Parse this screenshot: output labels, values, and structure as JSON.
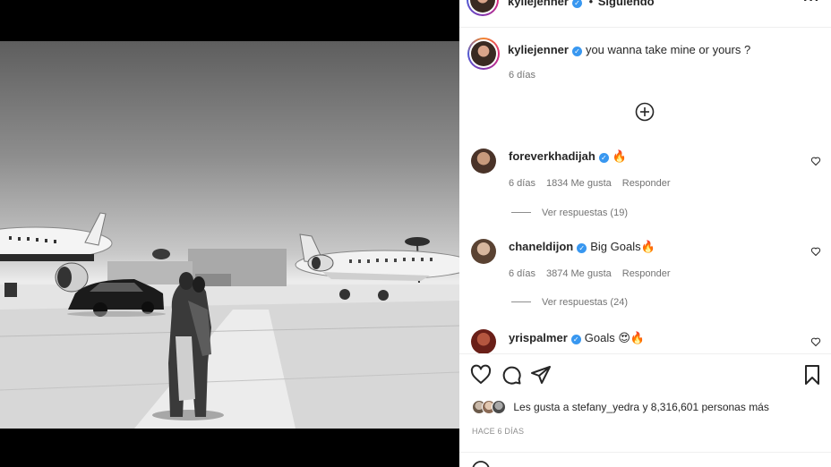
{
  "post": {
    "author": "kyliejenner",
    "follow_status": "Siguiendo",
    "more_icon": "more-horizontal-icon",
    "caption": {
      "username": "kyliejenner",
      "text": "you wanna take mine or yours ?",
      "time": "6 días"
    }
  },
  "load_more_icon": "plus-circle-icon",
  "comments": [
    {
      "username": "foreverkhadijah",
      "text": "🔥",
      "time": "6 días",
      "likes": "1834 Me gusta",
      "reply_label": "Responder",
      "view_replies": "Ver respuestas (19)"
    },
    {
      "username": "chaneldijon",
      "text": "Big Goals🔥",
      "time": "6 días",
      "likes": "3874 Me gusta",
      "reply_label": "Responder",
      "view_replies": "Ver respuestas (24)"
    },
    {
      "username": "yrispalmer",
      "text": "Goals 😍🔥"
    }
  ],
  "actions": {
    "like_icon": "heart-icon",
    "comment_icon": "comment-icon",
    "share_icon": "send-icon",
    "save_icon": "bookmark-icon"
  },
  "likes": {
    "text": "Les gusta a stefany_yedra y 8,316,601 personas más"
  },
  "posted_time": "HACE 6 DÍAS",
  "colors": {
    "verified": "#3897f0",
    "text": "#262626",
    "secondary": "#737373"
  }
}
